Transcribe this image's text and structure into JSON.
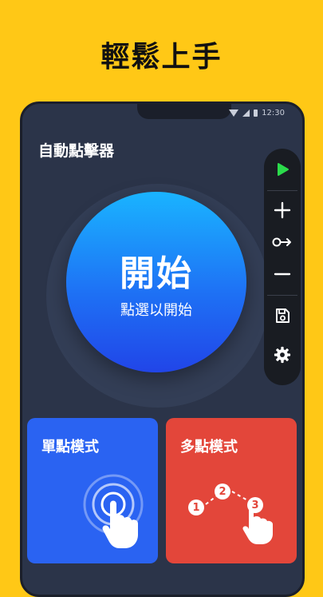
{
  "headline": "輕鬆上手",
  "status": {
    "time": "12:30"
  },
  "app": {
    "title": "自動點擊器"
  },
  "start_button": {
    "label": "開始",
    "sublabel": "點選以開始"
  },
  "toolbar": {
    "items": [
      {
        "name": "play-icon",
        "color": "#2BDB4B"
      },
      {
        "name": "plus-icon"
      },
      {
        "name": "swipe-icon"
      },
      {
        "name": "minus-icon"
      },
      {
        "name": "save-icon"
      },
      {
        "name": "gear-icon"
      }
    ]
  },
  "cards": {
    "single": {
      "label": "單點模式",
      "color": "#2A63F2"
    },
    "multi": {
      "label": "多點模式",
      "color": "#E3463A",
      "steps": [
        "1",
        "2",
        "3"
      ]
    }
  },
  "colors": {
    "background": "#FFC816",
    "phone": "#2B3449",
    "accent": "#1E72F5"
  }
}
